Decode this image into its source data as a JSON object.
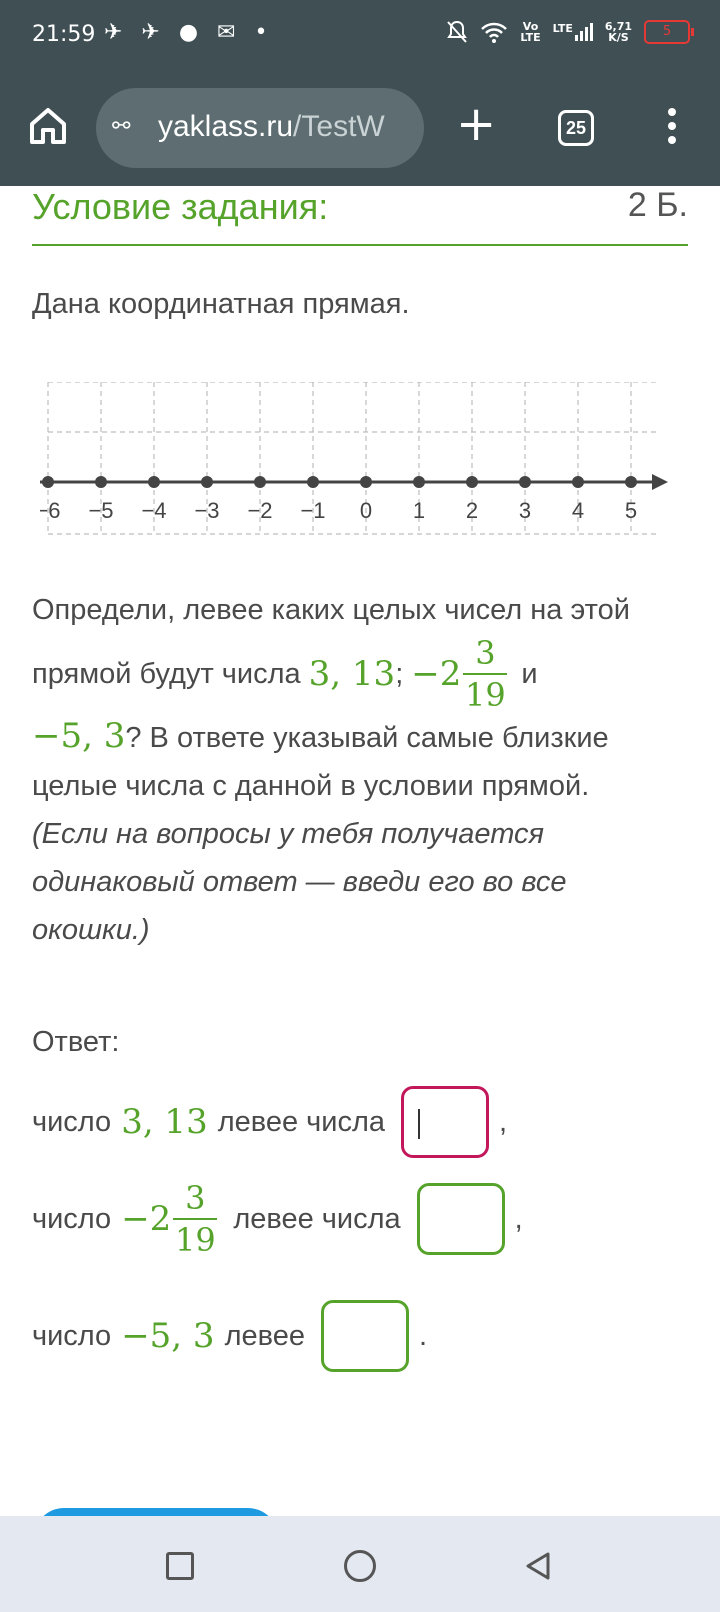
{
  "status": {
    "time": "21:59",
    "app_icons": "✈ ✈ ● ✉ •",
    "signal_vo": "Vo",
    "signal_lte": "LTE",
    "lte": "LTE",
    "speed": "6,71",
    "speed_unit": "K/S",
    "battery": "5"
  },
  "browser": {
    "url_domain": "yaklass.ru",
    "url_path": "/TestW",
    "tab_count": "25"
  },
  "task": {
    "title": "Условие задания:",
    "points": "2 Б.",
    "given": "Дана координатная прямая.",
    "number_line": {
      "ticks": [
        "−6",
        "−5",
        "−4",
        "−3",
        "−2",
        "−1",
        "0",
        "1",
        "2",
        "3",
        "4",
        "5"
      ]
    },
    "q_line1": "Определи, левее каких целых чисел на этой",
    "q_line2_prefix": "прямой будут числа",
    "n1": "3, 13",
    "sep1": ";",
    "n2_whole": "−2",
    "n2_num": "3",
    "n2_den": "19",
    "and": "и",
    "n3": "−5, 3",
    "q_line3_rest": "? В ответе указывай самые близкие целые числа с данной в условии прямой.",
    "q_note": "(Если на вопросы у тебя получается одинаковый ответ — введи его во все окошки.)"
  },
  "answer": {
    "label": "Ответ:",
    "row1_word": "число",
    "row1_num": "3, 13",
    "row1_text": "левее числа",
    "row1_end": ",",
    "row2_word": "число",
    "row2_whole": "−2",
    "row2_num": "3",
    "row2_den": "19",
    "row2_text": "левее числа",
    "row2_end": ",",
    "row3_word": "число",
    "row3_num": "−5, 3",
    "row3_text": "левее",
    "row3_end": "."
  },
  "colors": {
    "accent_green": "#56a32b",
    "focus_border": "#c2185b",
    "chrome": "#3f4f54"
  }
}
